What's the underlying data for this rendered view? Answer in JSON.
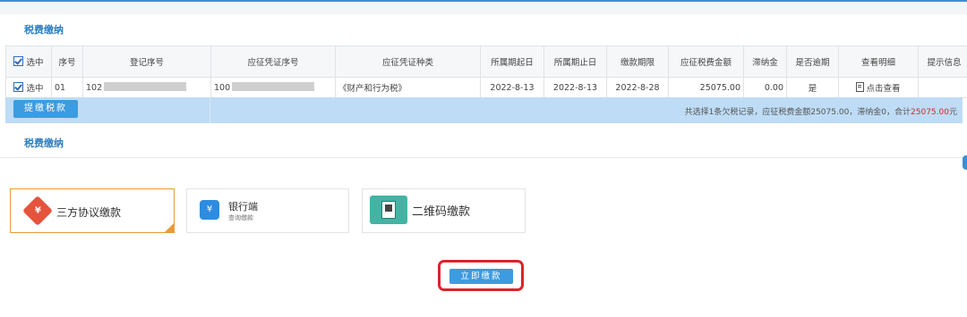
{
  "section1_title": "税费缴纳",
  "section2_title": "税费缴纳",
  "table": {
    "headers": [
      "选中",
      "序号",
      "登记序号",
      "应征凭证序号",
      "应征凭证种类",
      "所属期起日",
      "所属期止日",
      "缴款期限",
      "应征税费金额",
      "滞纳金",
      "是否逾期",
      "查看明细",
      "提示信息"
    ],
    "row": {
      "selected": "选中",
      "index": "01",
      "reg_no_prefix": "102",
      "voucher_no_prefix": "100",
      "voucher_type": "《财产和行为税》",
      "period_start": "2022-8-13",
      "period_end": "2022-8-13",
      "deadline": "2022-8-28",
      "amount": "25075.00",
      "late_fee": "0.00",
      "overdue": "是",
      "view_detail": "点击查看",
      "hint": ""
    }
  },
  "toolbar": {
    "pay_tax_label": "提缴税款",
    "summary_text": "共选择1条欠税记录，应征税费金额25075.00，滞纳金0，合计",
    "summary_total": "25075.00",
    "summary_unit": "元"
  },
  "payment_options": [
    {
      "label": "三方协议缴款",
      "icon": "tax-agreement-icon"
    },
    {
      "label": "银行端",
      "sub": "查询缴款",
      "icon": "bank-icon"
    },
    {
      "label": "二维码缴款",
      "icon": "qr-code-icon"
    }
  ],
  "pay_now_label": "立即缴款",
  "colors": {
    "accent": "#2d7fc1",
    "button": "#3d9be0",
    "bar": "#bedcf5",
    "highlight": "#d9252a",
    "selected_border": "#e99a3b"
  }
}
